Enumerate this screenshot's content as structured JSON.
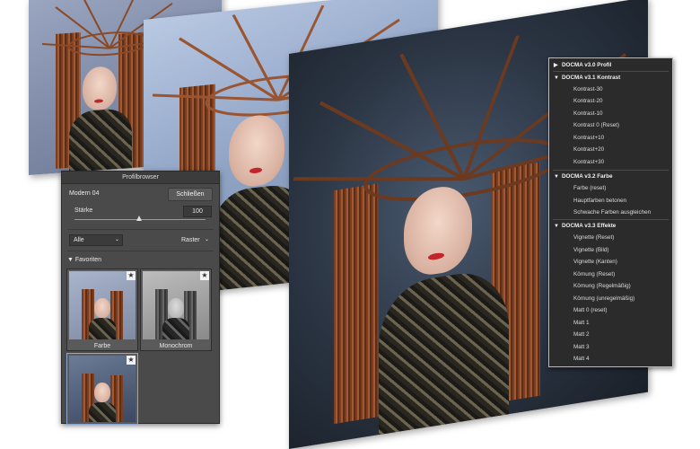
{
  "profile_browser": {
    "title": "Profilbrowser",
    "profile_name": "Modern 04",
    "close_label": "Schließen",
    "strength_label": "Stärke",
    "strength_value": "100",
    "filter_all": "Alle",
    "view_mode": "Raster",
    "favorites_label": "Favoriten",
    "thumbnails": [
      {
        "caption": "Farbe"
      },
      {
        "caption": "Monochrom"
      },
      {
        "caption": ""
      }
    ]
  },
  "docma_menu": {
    "groups": [
      {
        "label": "DOCMA v3.0 Profil",
        "expanded": false,
        "items": []
      },
      {
        "label": "DOCMA v3.1 Kontrast",
        "expanded": true,
        "items": [
          "Kontrast-30",
          "Kontrast-20",
          "Kontrast-10",
          "Kontrast 0 (Reset)",
          "Kontrast+10",
          "Kontrast+20",
          "Kontrast+30"
        ]
      },
      {
        "label": "DOCMA v3.2 Farbe",
        "expanded": true,
        "items": [
          "Farbe (reset)",
          "Hauptfarben betonen",
          "Schwache Farben ausgleichen"
        ]
      },
      {
        "label": "DOCMA v3.3 Effekte",
        "expanded": true,
        "items": [
          "Vignette (Reset)",
          "Vignette (Bild)",
          "Vignette (Kanten)",
          "Körnung (Reset)",
          "Körnung (Regelmäßig)",
          "Körnung (unregelmäßig)",
          "Matt 0 (reset)",
          "Matt 1",
          "Matt 2",
          "Matt 3",
          "Matt 4"
        ]
      }
    ]
  },
  "colors": {
    "panel_bg": "#4a4a4a",
    "menu_bg": "#2b2b2b",
    "hair": "#a35a33",
    "lips": "#c0262b"
  }
}
